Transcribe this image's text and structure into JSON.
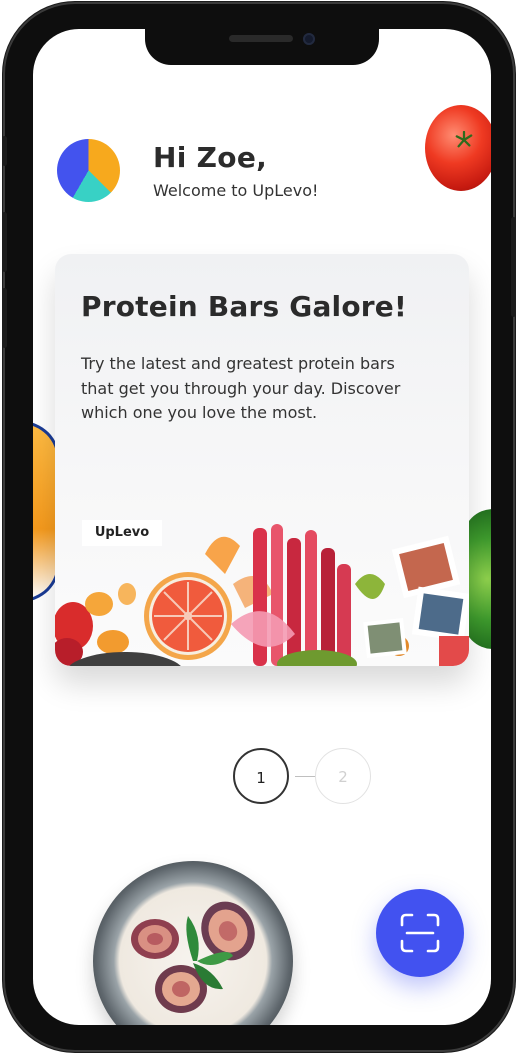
{
  "header": {
    "greeting": "Hi Zoe,",
    "welcome": "Welcome to UpLevo!"
  },
  "card": {
    "title": "Protein Bars Galore!",
    "description": "Try the latest and greatest protein bars that get you through your day. Discover which one you love the most.",
    "brand": "UpLevo"
  },
  "pager": {
    "pages": [
      "1",
      "2"
    ],
    "active": "1"
  },
  "colors": {
    "accent": "#4252f0",
    "logo_orange": "#f7a91d",
    "logo_teal": "#38d1c5",
    "logo_blue": "#4353ee"
  },
  "icons": {
    "fab": "scan-icon"
  }
}
